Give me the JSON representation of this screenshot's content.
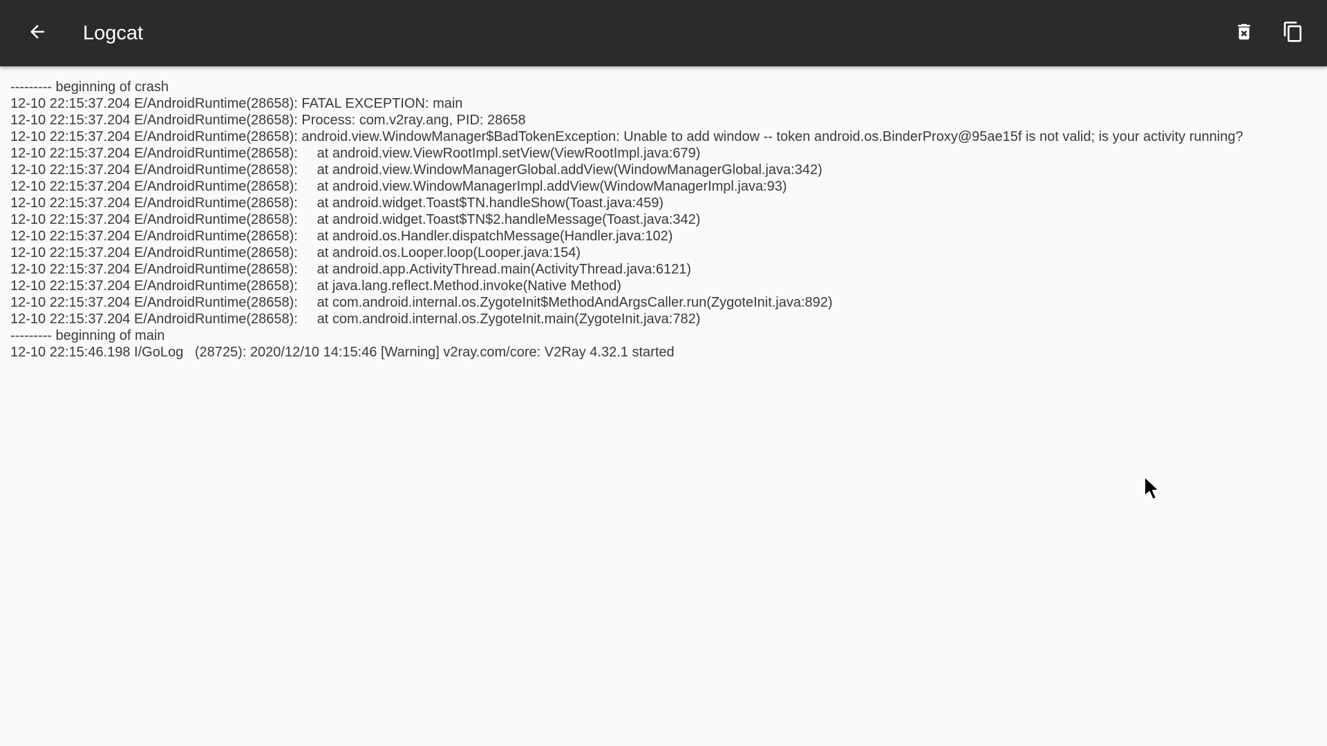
{
  "toolbar": {
    "title": "Logcat",
    "back_icon": "arrow-back-icon",
    "delete_icon": "delete-icon",
    "copy_icon": "copy-icon"
  },
  "log": {
    "lines": [
      "--------- beginning of crash",
      "12-10 22:15:37.204 E/AndroidRuntime(28658): FATAL EXCEPTION: main",
      "12-10 22:15:37.204 E/AndroidRuntime(28658): Process: com.v2ray.ang, PID: 28658",
      "12-10 22:15:37.204 E/AndroidRuntime(28658): android.view.WindowManager$BadTokenException: Unable to add window -- token android.os.BinderProxy@95ae15f is not valid; is your activity running?",
      "12-10 22:15:37.204 E/AndroidRuntime(28658): \tat android.view.ViewRootImpl.setView(ViewRootImpl.java:679)",
      "12-10 22:15:37.204 E/AndroidRuntime(28658): \tat android.view.WindowManagerGlobal.addView(WindowManagerGlobal.java:342)",
      "12-10 22:15:37.204 E/AndroidRuntime(28658): \tat android.view.WindowManagerImpl.addView(WindowManagerImpl.java:93)",
      "12-10 22:15:37.204 E/AndroidRuntime(28658): \tat android.widget.Toast$TN.handleShow(Toast.java:459)",
      "12-10 22:15:37.204 E/AndroidRuntime(28658): \tat android.widget.Toast$TN$2.handleMessage(Toast.java:342)",
      "12-10 22:15:37.204 E/AndroidRuntime(28658): \tat android.os.Handler.dispatchMessage(Handler.java:102)",
      "12-10 22:15:37.204 E/AndroidRuntime(28658): \tat android.os.Looper.loop(Looper.java:154)",
      "12-10 22:15:37.204 E/AndroidRuntime(28658): \tat android.app.ActivityThread.main(ActivityThread.java:6121)",
      "12-10 22:15:37.204 E/AndroidRuntime(28658): \tat java.lang.reflect.Method.invoke(Native Method)",
      "12-10 22:15:37.204 E/AndroidRuntime(28658): \tat com.android.internal.os.ZygoteInit$MethodAndArgsCaller.run(ZygoteInit.java:892)",
      "12-10 22:15:37.204 E/AndroidRuntime(28658): \tat com.android.internal.os.ZygoteInit.main(ZygoteInit.java:782)",
      "--------- beginning of main",
      "12-10 22:15:46.198 I/GoLog   (28725): 2020/12/10 14:15:46 [Warning] v2ray.com/core: V2Ray 4.32.1 started"
    ]
  },
  "colors": {
    "toolbar_bg": "#2b2b2b",
    "page_bg": "#fafafa",
    "text": "#3a3a3a",
    "icon": "#ffffff"
  }
}
